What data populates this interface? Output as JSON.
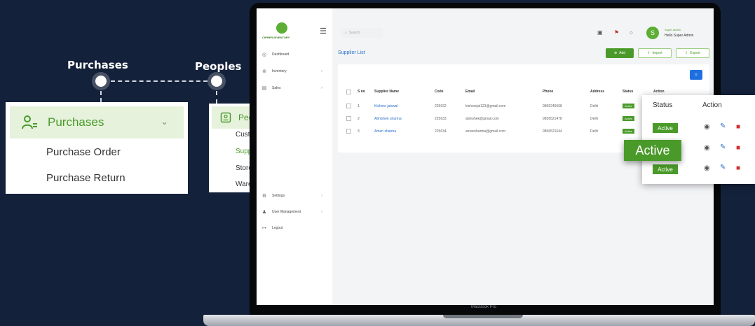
{
  "callouts": {
    "purchases_label": "Purchases",
    "peoples_label": "Peoples"
  },
  "purchases_menu": {
    "title": "Purchases",
    "items": [
      "Purchase Order",
      "Purchase Return"
    ]
  },
  "peoples_menu": {
    "title": "Peoples",
    "items": [
      "Customers",
      "Supplier",
      "Store",
      "Warehouse"
    ],
    "active_item": "Supplier"
  },
  "laptop": {
    "model_label": "MacBook Pro"
  },
  "app": {
    "brand": "CIPHER INVENTORY",
    "search_placeholder": "Search",
    "user": {
      "initial": "S",
      "role": "Super Admin",
      "name": "Hello Super Admin"
    },
    "sidebar": [
      {
        "label": "Dashboard",
        "icon": "dashboard-icon"
      },
      {
        "label": "Inventory",
        "icon": "cart-icon"
      },
      {
        "label": "Sales",
        "icon": "chart-icon"
      },
      {
        "label": "Settings",
        "icon": "gear-icon"
      },
      {
        "label": "User Management",
        "icon": "users-icon"
      },
      {
        "label": "Logout",
        "icon": "logout-icon"
      }
    ],
    "page_title": "Supplier List",
    "actions": {
      "add": "Add",
      "import": "Import",
      "export": "Export"
    },
    "table": {
      "headers": [
        "S no",
        "Supplier Name",
        "Code",
        "Email",
        "Phone",
        "Address",
        "Status",
        "Action"
      ],
      "rows": [
        {
          "sno": "1",
          "name": "Kishore jaiswal",
          "code": "225632",
          "email": "kishorejai123@gmail.com",
          "phone": "9865245568",
          "address": "Delhi",
          "status": "Active"
        },
        {
          "sno": "2",
          "name": "Abhishek sharma",
          "code": "225633",
          "email": "abhishek@gmail.com",
          "phone": "9856521478",
          "address": "Delhi",
          "status": "Active"
        },
        {
          "sno": "3",
          "name": "Aman sharma",
          "code": "225634",
          "email": "amansharma@gmail.com",
          "phone": "9856521644",
          "address": "Delhi",
          "status": "Active"
        }
      ]
    }
  },
  "status_overlay": {
    "headers": [
      "Status",
      "Action"
    ],
    "rows": [
      "Active",
      "Active",
      "Active"
    ],
    "highlight": "Active"
  },
  "colors": {
    "brand_green": "#4a9a2a",
    "link_blue": "#2a6fc9",
    "background": "#14213a"
  }
}
